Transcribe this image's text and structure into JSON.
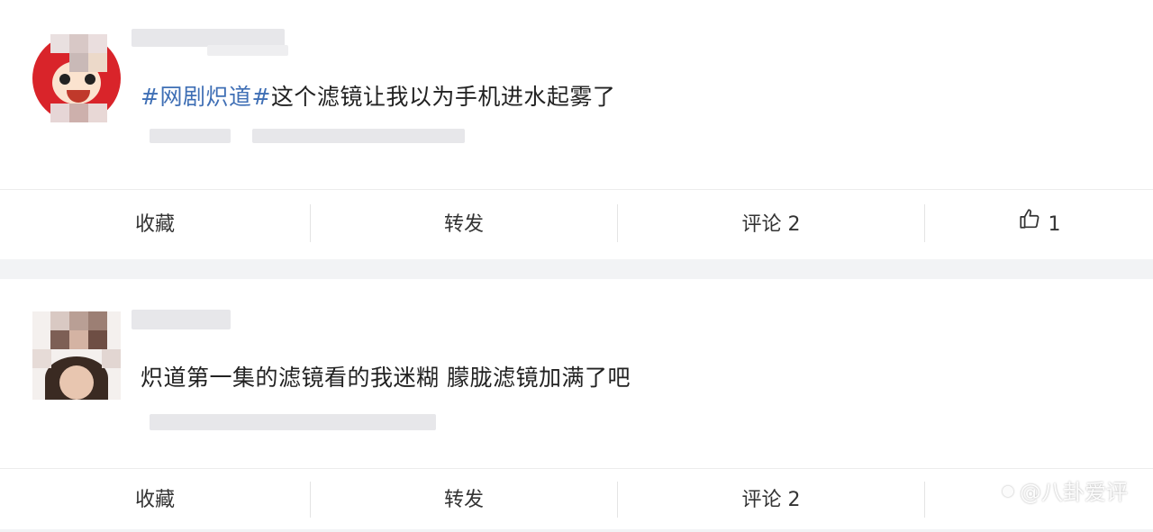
{
  "posts": [
    {
      "text_hashtag": "#网剧炽道#",
      "text_body": "这个滤镜让我以为手机进水起雾了",
      "actions": {
        "favorite": "收藏",
        "repost": "转发",
        "comment": "评论 2",
        "like_count": "1"
      }
    },
    {
      "text_body": "炽道第一集的滤镜看的我迷糊 朦胧滤镜加满了吧",
      "actions": {
        "favorite": "收藏",
        "repost": "转发",
        "comment": "评论 2"
      }
    }
  ],
  "watermark": "@八卦爱评",
  "colors": {
    "hashtag": "#3f6fb5",
    "text": "#222222",
    "background": "#f2f3f5"
  },
  "icons": {
    "like": "thumbs-up-icon",
    "watermark": "paw-icon"
  }
}
